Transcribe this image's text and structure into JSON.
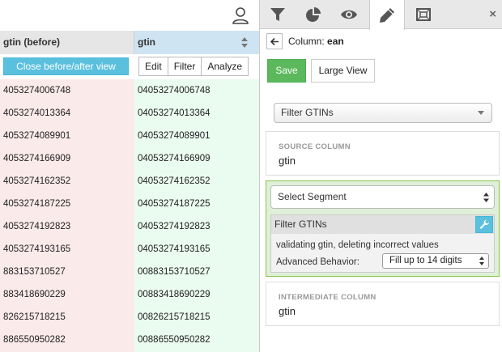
{
  "grid": {
    "before_column": {
      "header": "gtin (before)",
      "close_button_label": "Close before/after view",
      "values": [
        "4053274006748",
        "4053274013364",
        "4053274089901",
        "4053274166909",
        "4053274162352",
        "4053274187225",
        "4053274192823",
        "4053274193165",
        "883153710527",
        "883418690229",
        "826215718215",
        "886550950282"
      ]
    },
    "after_column": {
      "header": "gtin",
      "buttons": [
        "Edit",
        "Filter",
        "Analyze"
      ],
      "values": [
        "04053274006748",
        "04053274013364",
        "04053274089901",
        "04053274166909",
        "04053274162352",
        "04053274187225",
        "04053274192823",
        "04053274193165",
        "00883153710527",
        "00883418690229",
        "00826215718215",
        "00886550950282"
      ]
    }
  },
  "panel": {
    "tabs": [
      {
        "icon": "filter-icon"
      },
      {
        "icon": "pie-chart-icon"
      },
      {
        "icon": "eye-icon"
      },
      {
        "icon": "pencil-icon",
        "active": true
      },
      {
        "icon": "frame-icon"
      }
    ],
    "close_glyph": "×",
    "column_label_prefix": "Column:",
    "column_name": "ean",
    "save_label": "Save",
    "large_view_label": "Large View",
    "operation_select": "Filter GTINs",
    "source": {
      "title": "SOURCE COLUMN",
      "value": "gtin"
    },
    "segment": {
      "select_value": "Select Segment",
      "filter_title": "Filter GTINs",
      "description": "validating gtin, deleting incorrect values",
      "advanced_label": "Advanced Behavior:",
      "advanced_value": "Fill up to 14 digits"
    },
    "intermediate": {
      "title": "INTERMEDIATE COLUMN",
      "value": "gtin"
    }
  },
  "colors": {
    "before_bg": "#fbeaea",
    "after_bg": "#eafbef",
    "info_blue": "#5bc0de",
    "save_green": "#5cb85c",
    "segment_green": "#dff0d8"
  }
}
